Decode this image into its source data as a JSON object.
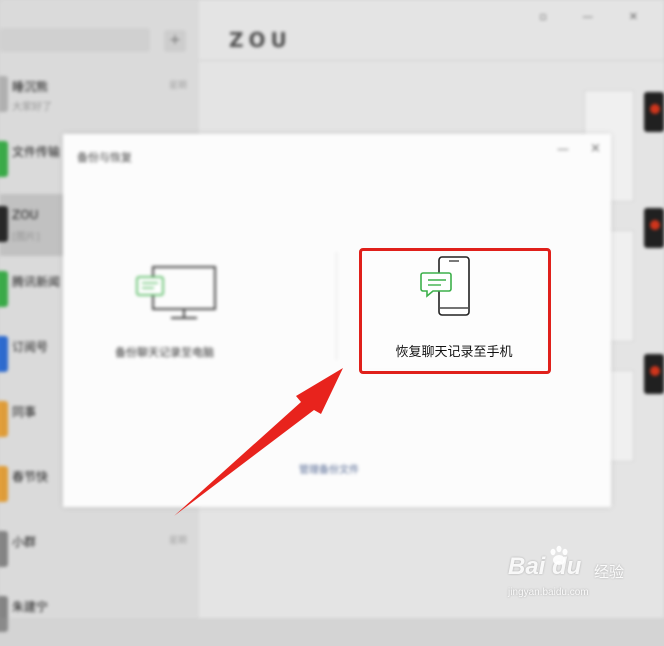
{
  "sidebar": {
    "search_placeholder": "",
    "add_label": "+",
    "conversations": [
      {
        "name": "睡沉熊",
        "preview": "大家好了",
        "time": "星期",
        "avatar_color": "#b8b8b8"
      },
      {
        "name": "文件传输",
        "preview": "",
        "time": "",
        "avatar_color": "#3db04b"
      },
      {
        "name": "ZOU",
        "preview": "[图片]",
        "time": "",
        "avatar_color": "#2a2a2a"
      },
      {
        "name": "腾讯新闻",
        "preview": "",
        "time": "",
        "avatar_color": "#3db04b"
      },
      {
        "name": "订阅号",
        "preview": "",
        "time": "",
        "avatar_color": "#2f6fd6"
      },
      {
        "name": "同事",
        "preview": "",
        "time": "",
        "avatar_color": "#e8a33c"
      },
      {
        "name": "春节快",
        "preview": "",
        "time": "",
        "avatar_color": "#e8a33c"
      },
      {
        "name": "小群",
        "preview": "",
        "time": "星期",
        "avatar_color": "#8a8a8a"
      },
      {
        "name": "朱建宁",
        "preview": "",
        "time": "",
        "avatar_color": "#8a8a8a"
      }
    ]
  },
  "chat": {
    "title": "ZOU",
    "timestamp": ""
  },
  "dialog": {
    "title": "备份与恢复",
    "min_label": "—",
    "close_label": "×",
    "option_backup_label": "备份聊天记录至电脑",
    "option_restore_label": "恢复聊天记录至手机",
    "manage_link": "管理备份文件"
  },
  "watermark": {
    "brand": "Bai  du",
    "cn": "经验",
    "url": "jingyan.baidu.com"
  },
  "colors": {
    "highlight": "#e0201b",
    "arrow": "#e8231d",
    "wechat_green": "#3db04b"
  }
}
